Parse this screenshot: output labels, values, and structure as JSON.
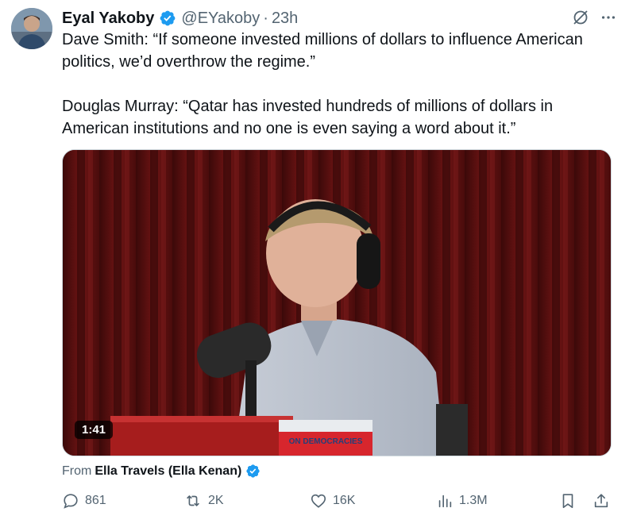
{
  "author": {
    "name": "Eyal Yakoby",
    "handle": "@EYakoby",
    "time": "23h",
    "separator": "·"
  },
  "tweet": {
    "paragraph1": "Dave Smith: “If someone invested millions of dollars to influence American politics, we’d overthrow the regime.”",
    "paragraph2": "Douglas Murray: “Qatar has invested hundreds of millions of dollars in American institutions and no one is even saying a word about it.”"
  },
  "media": {
    "duration": "1:41",
    "book_text": "ON DEMOCRACIES"
  },
  "source": {
    "prefix": "From",
    "name": "Ella Travels (Ella Kenan)"
  },
  "actions": {
    "replies": "861",
    "reposts": "2K",
    "likes": "16K",
    "views": "1.3M"
  },
  "colors": {
    "verified": "#1d9bf0",
    "secondary_text": "#536471",
    "primary_text": "#0f1419"
  }
}
